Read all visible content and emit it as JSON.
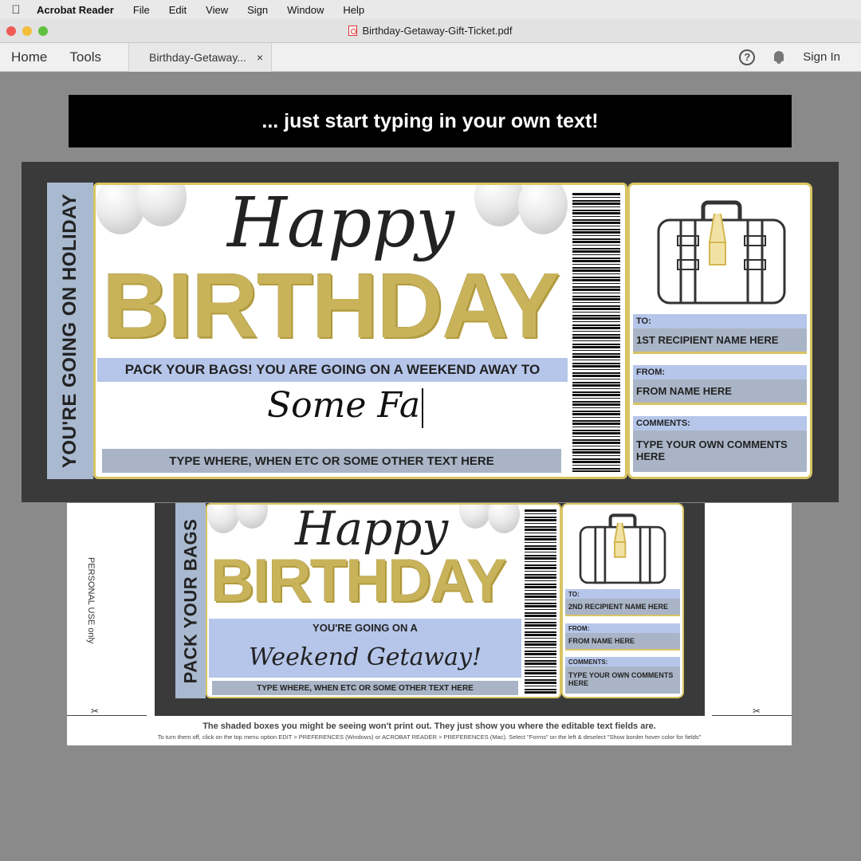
{
  "menubar": {
    "app_name": "Acrobat Reader",
    "items": [
      "File",
      "Edit",
      "View",
      "Sign",
      "Window",
      "Help"
    ]
  },
  "window": {
    "title": "Birthday-Getaway-Gift-Ticket.pdf"
  },
  "toolbar": {
    "home": "Home",
    "tools": "Tools",
    "doc_tab": "Birthday-Getaway...",
    "close": "×",
    "help": "?",
    "sign_in": "Sign In"
  },
  "banner": "... just start typing in your own text!",
  "ticket1": {
    "side_text": "YOU'RE GOING ON HOLIDAY",
    "happy": "Happy",
    "birthday": "BIRTHDAY",
    "band_text": "PACK YOUR BAGS! YOU ARE GOING ON A WEEKEND AWAY TO",
    "typed_text": "Some Fa",
    "bottom_text": "TYPE WHERE, WHEN ETC OR  SOME OTHER TEXT HERE",
    "to_label": "TO:",
    "to_value": "1ST RECIPIENT NAME HERE",
    "from_label": "FROM:",
    "from_value": "FROM NAME HERE",
    "comments_label": "COMMENTS:",
    "comments_value": "TYPE YOUR OWN COMMENTS HERE"
  },
  "ticket2": {
    "side_text": "PACK YOUR BAGS",
    "happy": "Happy",
    "birthday": "BIRTHDAY",
    "band_text": "YOU'RE GOING ON A",
    "script_text": "Weekend Getaway!",
    "bottom_text": "TYPE WHERE, WHEN ETC OR  SOME OTHER TEXT HERE",
    "to_label": "TO:",
    "to_value": "2ND RECIPIENT NAME HERE",
    "from_label": "FROM:",
    "from_value": "FROM NAME HERE",
    "comments_label": "COMMENTS:",
    "comments_value": "TYPE YOUR OWN COMMENTS HERE"
  },
  "page_notes": {
    "personal_use": "PERSONAL USE only",
    "main": "The shaded boxes you might be seeing won't print out. They just show you where the editable text fields are.",
    "small": "To turn them off, click on the top menu option EDIT > PREFERENCES (Windows) or ACROBAT READER > PREFERENCES (Mac). Select \"Forms\" on the left  & deselect \"Show border hover color for fields\""
  },
  "colors": {
    "gold": "#d8c463",
    "blue_field": "#b6c6ea",
    "grey_field": "#a9b5c6",
    "ticket_bg": "#3a3a3a"
  }
}
